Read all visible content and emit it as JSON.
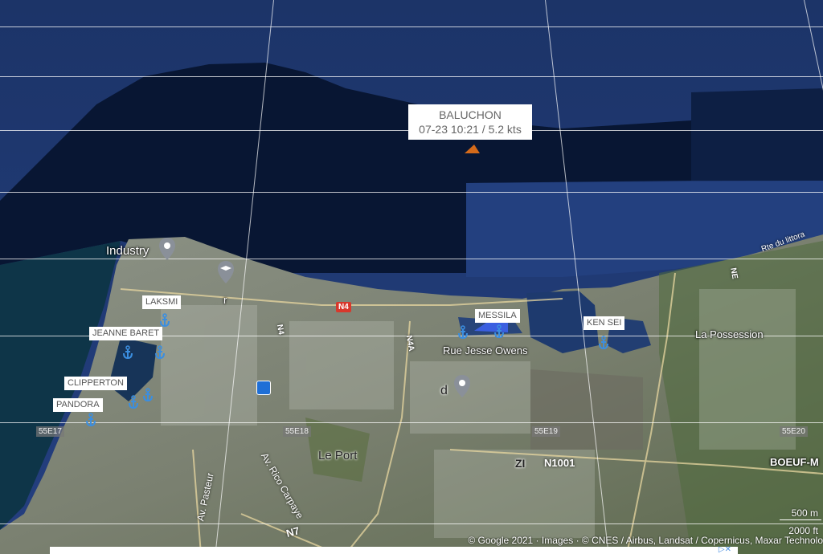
{
  "vessel_popup": {
    "name": "BALUCHON",
    "detail": "07-23 10:21 / 5.2 kts"
  },
  "ship_labels": [
    "LAKSMI",
    "JEANNE BARET",
    "CLIPPERTON",
    "PANDORA",
    "MESSILA",
    "KEN SEI"
  ],
  "places": {
    "industry": "Industry",
    "la_possession": "La Possession",
    "le_port": "Le Port",
    "rue_jesse_owens": "Rue Jesse Owens",
    "boeuf_mort": "BOEUF-M",
    "zi": "ZI",
    "d": "d",
    "r": "r"
  },
  "roads": {
    "n4": "N4",
    "n4_vertical": "N4",
    "n4a": "N4A",
    "n1001": "N1001",
    "n7": "N7",
    "ne": "NE",
    "av_pasteur": "Av. Pasteur",
    "av_rico": "Av. Rico Carpaye",
    "rte_littoral": "Rte du littora"
  },
  "grid_labels": [
    "55E17",
    "55E18",
    "55E19",
    "55E20"
  ],
  "scale": {
    "metric": "500 m",
    "imperial": "2000 ft"
  },
  "attribution": "© Google 2021 · Images · © CNES / Airbus, Landsat / Copernicus, Maxar Technolo",
  "ad_close": "▷✕",
  "colors": {
    "deep_sea": "#0a1a38",
    "sea": "#1d3a7a",
    "land": "#7d8476",
    "vessel": "#d46a1a",
    "anchor": "#3b8ee0"
  }
}
